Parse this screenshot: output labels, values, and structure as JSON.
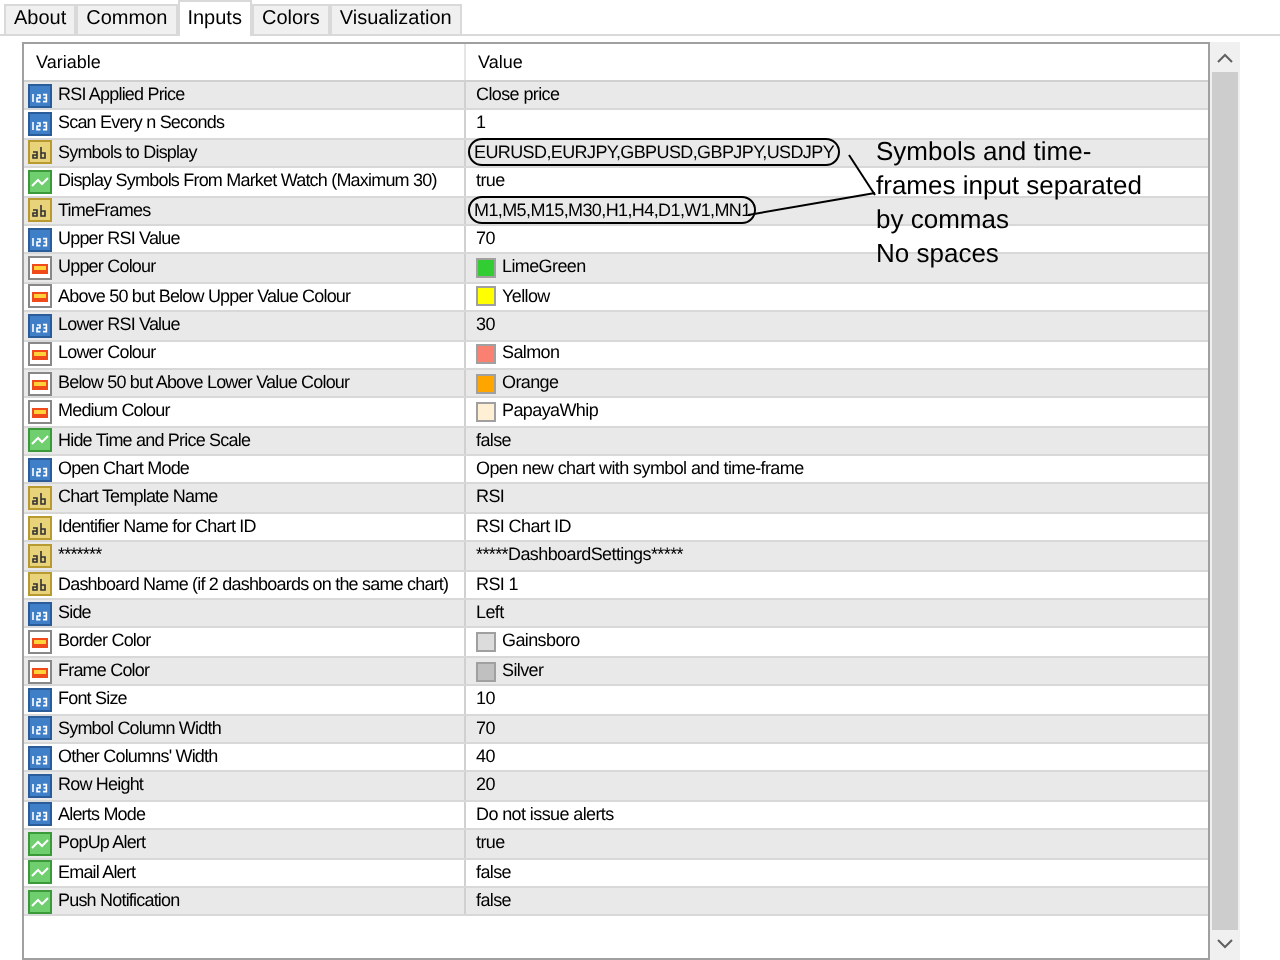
{
  "tabs": [
    {
      "label": "About",
      "selected": false
    },
    {
      "label": "Common",
      "selected": false
    },
    {
      "label": "Inputs",
      "selected": true
    },
    {
      "label": "Colors",
      "selected": false
    },
    {
      "label": "Visualization",
      "selected": false
    }
  ],
  "table": {
    "columns": [
      "Variable",
      "Value"
    ],
    "rows": [
      {
        "kind": "int",
        "variable": "RSI Applied Price",
        "value": "Close price"
      },
      {
        "kind": "int",
        "variable": "Scan Every n Seconds",
        "value": "1"
      },
      {
        "kind": "string",
        "variable": "Symbols to Display",
        "value": "EURUSD,EURJPY,GBPUSD,GBPJPY,USDJPY",
        "circled": true
      },
      {
        "kind": "bool",
        "variable": "Display Symbols From Market Watch (Maximum 30)",
        "value": "true"
      },
      {
        "kind": "string",
        "variable": "TimeFrames",
        "value": "M1,M5,M15,M30,H1,H4,D1,W1,MN1",
        "circled": true
      },
      {
        "kind": "int",
        "variable": "Upper RSI Value",
        "value": "70"
      },
      {
        "kind": "color",
        "variable": "Upper Colour",
        "value": "LimeGreen",
        "color": "#32cd32"
      },
      {
        "kind": "color",
        "variable": "Above 50 but Below Upper Value Colour",
        "value": "Yellow",
        "color": "#ffff00"
      },
      {
        "kind": "int",
        "variable": "Lower RSI Value",
        "value": "30"
      },
      {
        "kind": "color",
        "variable": "Lower Colour",
        "value": "Salmon",
        "color": "#fa8072"
      },
      {
        "kind": "color",
        "variable": "Below 50 but Above Lower Value Colour",
        "value": "Orange",
        "color": "#ffa500"
      },
      {
        "kind": "color",
        "variable": "Medium Colour",
        "value": "PapayaWhip",
        "color": "#ffefd5"
      },
      {
        "kind": "bool",
        "variable": "Hide Time and Price Scale",
        "value": "false"
      },
      {
        "kind": "int",
        "variable": "Open Chart Mode",
        "value": "Open new chart with symbol and time-frame"
      },
      {
        "kind": "string",
        "variable": "Chart Template Name",
        "value": "RSI"
      },
      {
        "kind": "string",
        "variable": "Identifier Name for Chart ID",
        "value": "RSI Chart ID"
      },
      {
        "kind": "string",
        "variable": "*******",
        "value": "*****DashboardSettings*****"
      },
      {
        "kind": "string",
        "variable": "Dashboard Name (if 2 dashboards on the same chart)",
        "value": "RSI 1"
      },
      {
        "kind": "int",
        "variable": "Side",
        "value": "Left"
      },
      {
        "kind": "color",
        "variable": "Border Color",
        "value": "Gainsboro",
        "color": "#dcdcdc"
      },
      {
        "kind": "color",
        "variable": "Frame Color",
        "value": "Silver",
        "color": "#c0c0c0"
      },
      {
        "kind": "int",
        "variable": "Font Size",
        "value": "10"
      },
      {
        "kind": "int",
        "variable": "Symbol Column Width",
        "value": "70"
      },
      {
        "kind": "int",
        "variable": "Other Columns' Width",
        "value": "40"
      },
      {
        "kind": "int",
        "variable": "Row Height",
        "value": "20"
      },
      {
        "kind": "int",
        "variable": "Alerts Mode",
        "value": "Do not issue alerts"
      },
      {
        "kind": "bool",
        "variable": "PopUp Alert",
        "value": "true"
      },
      {
        "kind": "bool",
        "variable": "Email Alert",
        "value": "false"
      },
      {
        "kind": "bool",
        "variable": "Push Notification",
        "value": "false"
      }
    ]
  },
  "annotation": {
    "lines": [
      "Symbols and time-",
      "frames input separated",
      "by commas",
      "No spaces"
    ]
  }
}
